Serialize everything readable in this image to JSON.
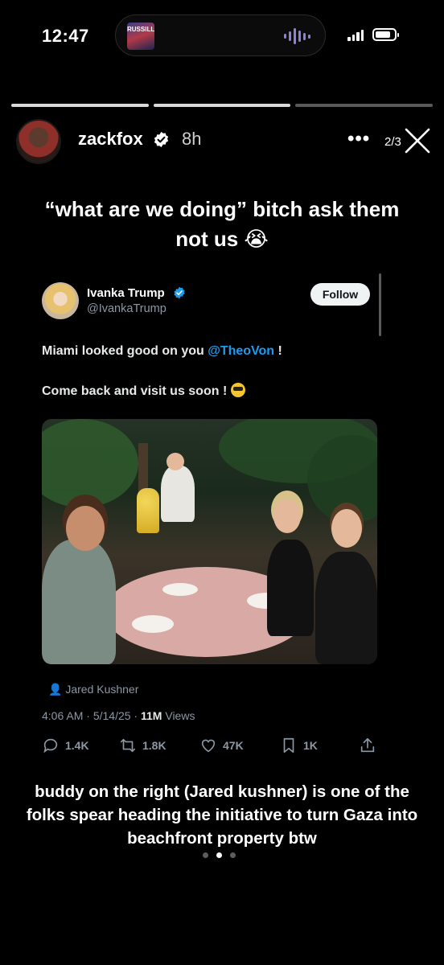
{
  "status_bar": {
    "time": "12:47",
    "island_thumb_text": "RUSSILLO"
  },
  "story": {
    "progress_segments": 3,
    "progress_active": 2,
    "username": "zackfox",
    "age": "8h",
    "more_glyph": "•••",
    "counter": "2/3",
    "caption": "“what are we doing” bitch ask them not us 😭",
    "caption_bottom": "buddy on the right (Jared kushner) is one of the folks spear heading the initiative to turn Gaza into beachfront property btw"
  },
  "tweet": {
    "display_name": "Ivanka Trump",
    "handle": "@IvankaTrump",
    "follow_label": "Follow",
    "text_line1_prefix": "Miami looked good on you ",
    "text_line1_mention": "@TheoVon",
    "text_line1_suffix": " !",
    "text_line2": "Come back and visit us soon !",
    "tagged_person": "Jared Kushner",
    "time": "4:06 AM",
    "date": "5/14/25",
    "views_count": "11M",
    "views_label": "Views",
    "replies": "1.4K",
    "reposts": "1.8K",
    "likes": "47K",
    "bookmarks": "1K"
  },
  "pager": {
    "dots": 3,
    "active": 1
  },
  "icons": {
    "verified_color": "#1d9bf0",
    "link_color": "#1d9bf0"
  }
}
